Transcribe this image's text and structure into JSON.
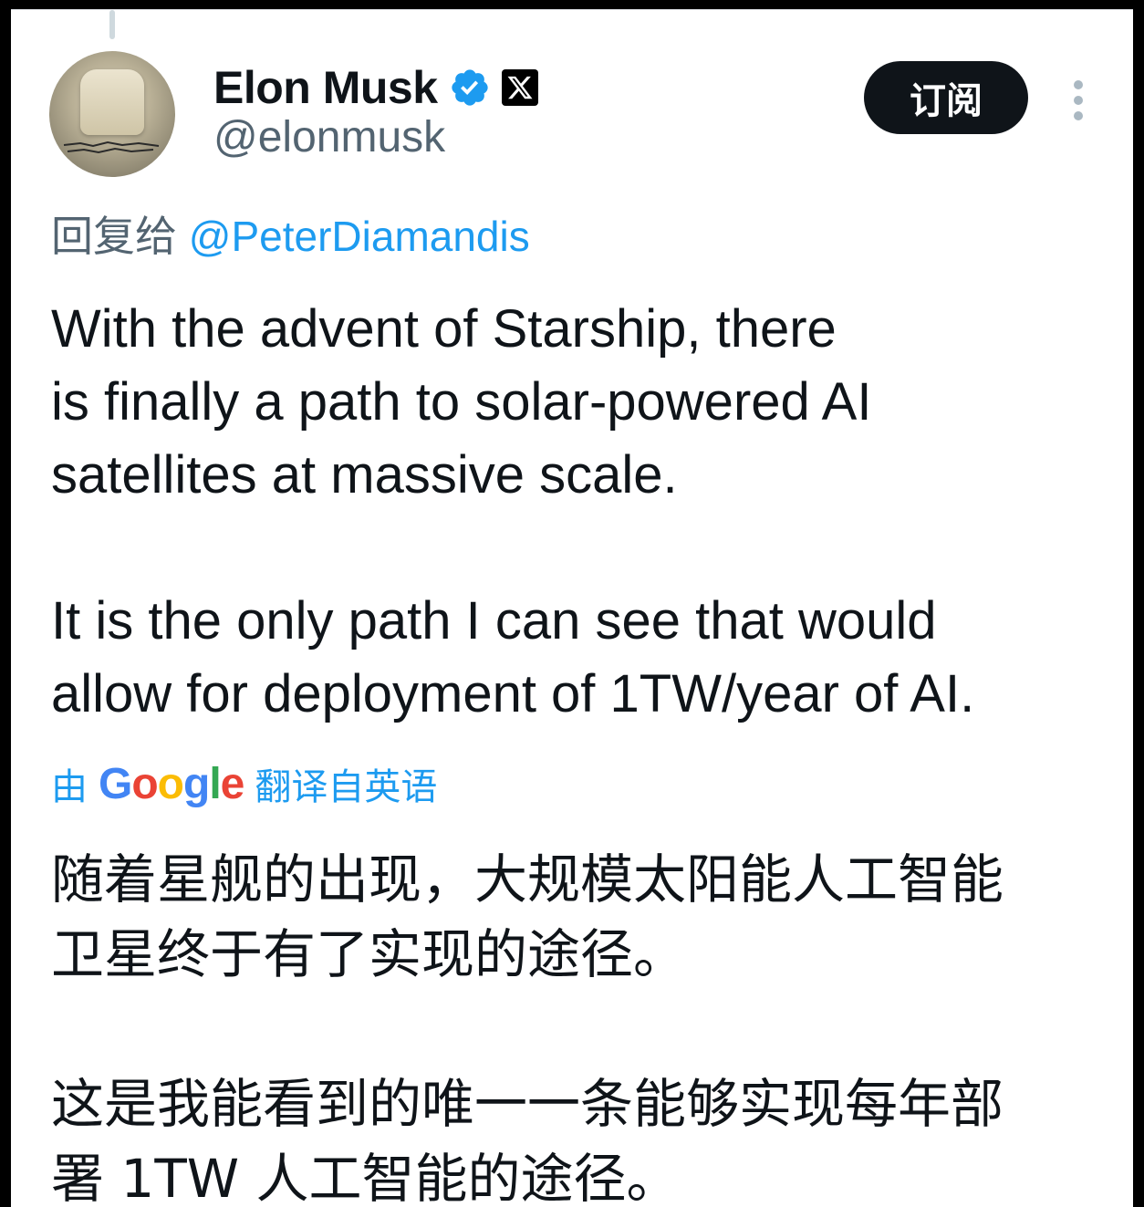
{
  "author": {
    "display_name": "Elon Musk",
    "handle": "@elonmusk"
  },
  "subscribe_button": {
    "label": "订阅"
  },
  "reply": {
    "prefix": "回复给",
    "to_handle": "@PeterDiamandis"
  },
  "tweet": {
    "lines_para1": [
      "With the advent of Starship, there",
      "is finally a path to solar-powered AI",
      "satellites at massive scale."
    ],
    "lines_para2": [
      "It is the only path I can see that would",
      "allow for deployment of 1TW/year of AI."
    ]
  },
  "translation": {
    "prefix": "由",
    "provider": "Google",
    "suffix": "翻译自英语",
    "lines_para1": [
      "随着星舰的出现，大规模太阳能人工智能",
      "卫星终于有了实现的途径。"
    ],
    "lines_para2": [
      "这是我能看到的唯一一条能够实现每年部",
      "署 1TW 人工智能的途径。"
    ]
  },
  "icons": {
    "verified": "verified-badge-icon",
    "x_logo": "x-logo-icon",
    "more": "more-vertical-icon"
  },
  "colors": {
    "accent_blue": "#1d9bf0",
    "text_primary": "#0f1419",
    "text_secondary": "#536471",
    "button_bg": "#0f1419",
    "google_blue": "#4285f4",
    "google_red": "#ea4335",
    "google_yellow": "#fbbc05",
    "google_green": "#34a853"
  }
}
